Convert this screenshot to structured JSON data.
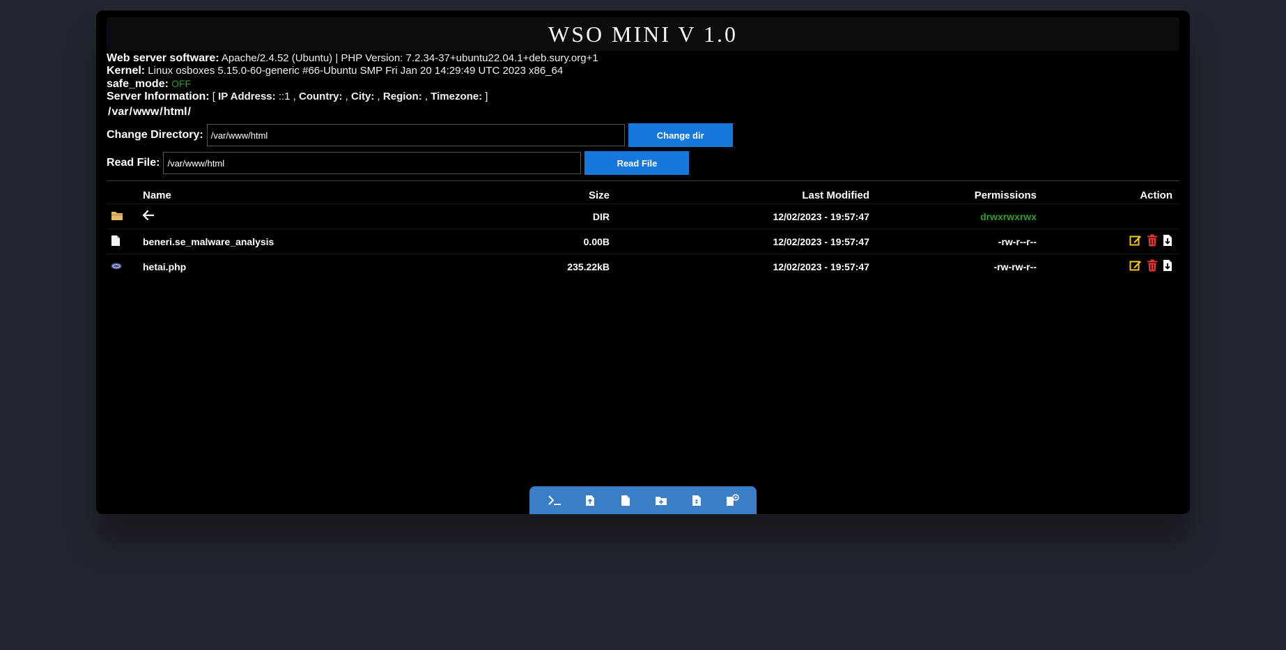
{
  "app": {
    "title": "WSO MINI V 1.0"
  },
  "info": {
    "web_server_label": "Web server software:",
    "web_server_value": "Apache/2.4.52 (Ubuntu) | PHP Version: 7.2.34-37+ubuntu22.04.1+deb.sury.org+1",
    "kernel_label": "Kernel:",
    "kernel_value": "Linux osboxes 5.15.0-60-generic #66-Ubuntu SMP Fri Jan 20 14:29:49 UTC 2023 x86_64",
    "safe_mode_label": "safe_mode:",
    "safe_mode_value": "OFF",
    "server_info_label": "Server Information:",
    "ip_label": "IP Address:",
    "ip_value": "::1",
    "country_label": "Country:",
    "city_label": "City:",
    "region_label": "Region:",
    "timezone_label": "Timezone:"
  },
  "path": {
    "segments": [
      "var",
      "www",
      "html"
    ]
  },
  "change_dir": {
    "label": "Change Directory:",
    "value": "/var/www/html",
    "button": "Change dir"
  },
  "read_file": {
    "label": "Read File:",
    "value": "/var/www/html",
    "button": "Read File"
  },
  "table": {
    "headers": {
      "name": "Name",
      "size": "Size",
      "modified": "Last Modified",
      "permissions": "Permissions",
      "action": "Action"
    },
    "rows": [
      {
        "icon": "folder-icon",
        "name": "",
        "size": "DIR",
        "modified": "12/02/2023 - 19:57:47",
        "permissions": "drwxrwxrwx"
      },
      {
        "icon": "file-icon",
        "name": "beneri.se_malware_analysis",
        "size": "0.00B",
        "modified": "12/02/2023 - 19:57:47",
        "permissions": "-rw-r--r--"
      },
      {
        "icon": "php-icon",
        "name": "hetai.php",
        "size": "235.22kB",
        "modified": "12/02/2023 - 19:57:47",
        "permissions": "-rw-rw-r--"
      }
    ]
  },
  "toolbar": {
    "icons": [
      "terminal-icon",
      "upload-file-icon",
      "new-file-icon",
      "new-folder-icon",
      "file-code-icon",
      "settings-icon"
    ]
  },
  "colors": {
    "accent": "#1778dc",
    "green": "#2ea02e",
    "toolbar": "#3a7fc5",
    "folder": "#e6b869",
    "edit": "#f5c518",
    "delete": "#e53935"
  }
}
